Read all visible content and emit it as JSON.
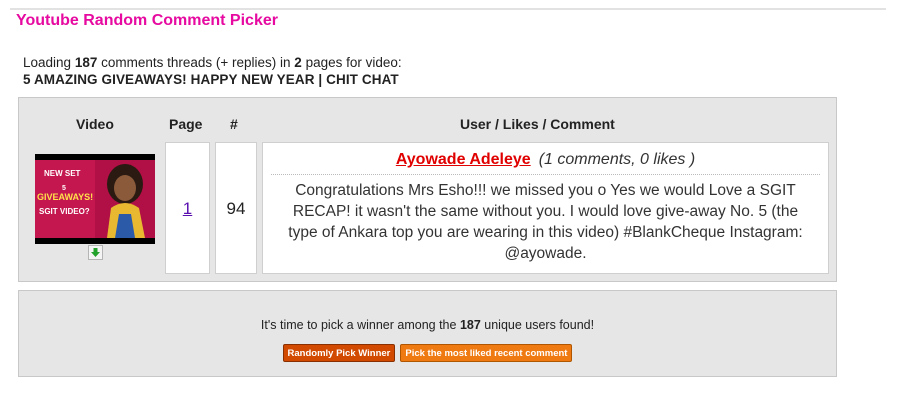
{
  "app": {
    "title": "Youtube Random Comment Picker"
  },
  "loading": {
    "prefix": "Loading ",
    "count": "187",
    "mid": " comments threads (+ replies) in ",
    "pages": "2",
    "suffix": " pages for video:",
    "video_title": "5 AMAZING GIVEAWAYS! HAPPY NEW YEAR | CHIT CHAT"
  },
  "table": {
    "headers": {
      "video": "Video",
      "page": "Page",
      "num": "#",
      "user": "User / Likes / Comment"
    },
    "row": {
      "page": "1",
      "number": "94",
      "user_name": "Ayowade Adeleye",
      "user_meta": "(1 comments, 0 likes )",
      "comment": "Congratulations Mrs Esho!!! we missed you o Yes we would Love a SGIT RECAP! it wasn't the same without you. I would love give-away No. 5 (the type of Ankara top you are wearing in this video) #BlankCheque Instagram: @ayowade.",
      "thumbnail_text": [
        "NEW SET",
        "5",
        "GIVEAWAYS!",
        "SGIT VIDEO?"
      ]
    }
  },
  "picker": {
    "prefix": "It's time to pick a winner among the ",
    "count": "187",
    "suffix": " unique users found!",
    "random_button": "Randomly Pick Winner",
    "liked_button": "Pick the most liked recent comment"
  },
  "colors": {
    "title": "#e60aa0",
    "user_name": "#e00000",
    "page_link": "#5a10b0",
    "button_random": "#d24a00",
    "button_liked": "#f07a12"
  },
  "icons": {
    "download": "download-arrow-icon"
  }
}
